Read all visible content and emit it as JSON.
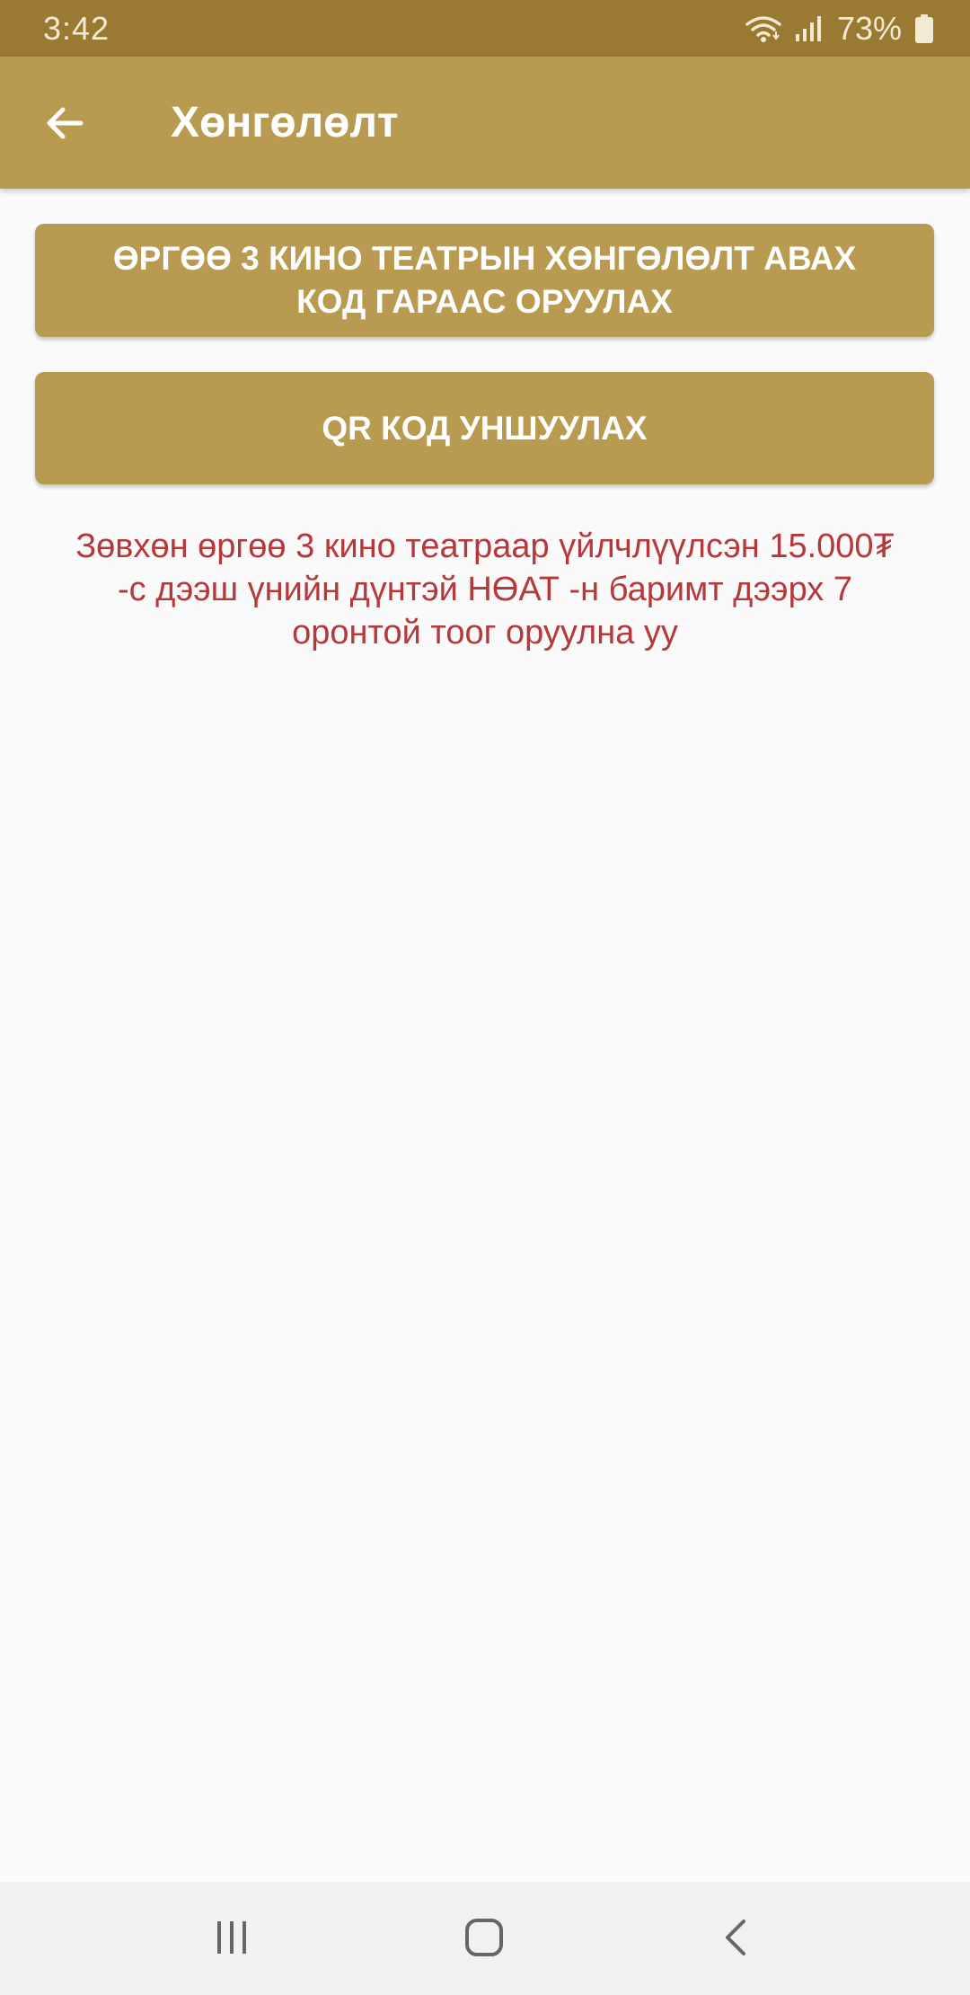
{
  "status_bar": {
    "time": "3:42",
    "battery": "73%",
    "icons": [
      "wifi-icon",
      "signal-icon",
      "battery-icon"
    ]
  },
  "app_bar": {
    "back_icon": "arrow-left-icon",
    "title": "Хөнгөлөлт"
  },
  "actions": {
    "manual_code": {
      "line1": "ӨРГӨӨ 3 КИНО ТЕАТРЫН ХӨНГӨЛӨЛТ АВАХ",
      "line2": "КОД ГАРААС ОРУУЛАХ"
    },
    "qr_code": {
      "label": "QR КОД УНШУУЛАХ"
    }
  },
  "info": {
    "line1": "Зөвхөн өргөө 3 кино театраар үйлчлүүлсэн 15.000₮",
    "line2": "-с дээш үнийн дүнтэй НӨАТ -н баримт дээрх 7",
    "line3": "оронтой тоог оруулна уу"
  },
  "nav_bar": {
    "icons": [
      "recent-apps-icon",
      "home-icon",
      "back-icon"
    ]
  },
  "colors": {
    "status_bar": "#9a7a33",
    "app_bar": "#b89a50",
    "button": "#b89a50",
    "info_text": "#b5383a",
    "background": "#fafafa"
  }
}
